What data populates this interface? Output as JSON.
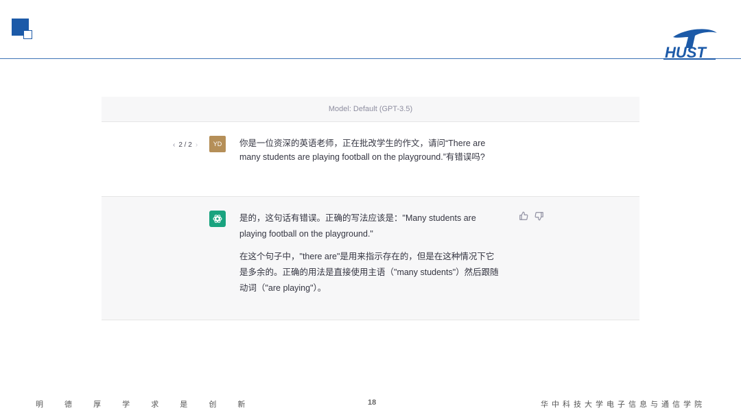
{
  "slide": {
    "page_number": "18",
    "footer_left": "明 德 厚 学 求 是 创 新",
    "footer_right": "华中科技大学电子信息与通信学院",
    "accent_color": "#1c5aa8",
    "logo_icon": "hust-logo"
  },
  "chat": {
    "model_label": "Model: Default (GPT-3.5)",
    "user_message": {
      "pager": "2 / 2",
      "avatar_initials": "YD",
      "text": "你是一位资深的英语老师，正在批改学生的作文，请问“There are many students are playing football on the playground.”有错误吗?"
    },
    "assistant_message": {
      "avatar_icon": "chatgpt-logo-icon",
      "paragraph_1": "是的，这句话有错误。正确的写法应该是：\"Many students are playing football on the playground.\"",
      "paragraph_2": "在这个句子中，\"there are\"是用来指示存在的，但是在这种情况下它是多余的。正确的用法是直接使用主语（\"many students\"）然后跟随动词（\"are playing\"）。",
      "feedback_icons": [
        "thumbs-up-icon",
        "thumbs-down-icon"
      ]
    },
    "colors": {
      "user_avatar": "#b58f58",
      "assistant_avatar": "#19a37f",
      "panel_gray": "#f7f7f8"
    }
  }
}
